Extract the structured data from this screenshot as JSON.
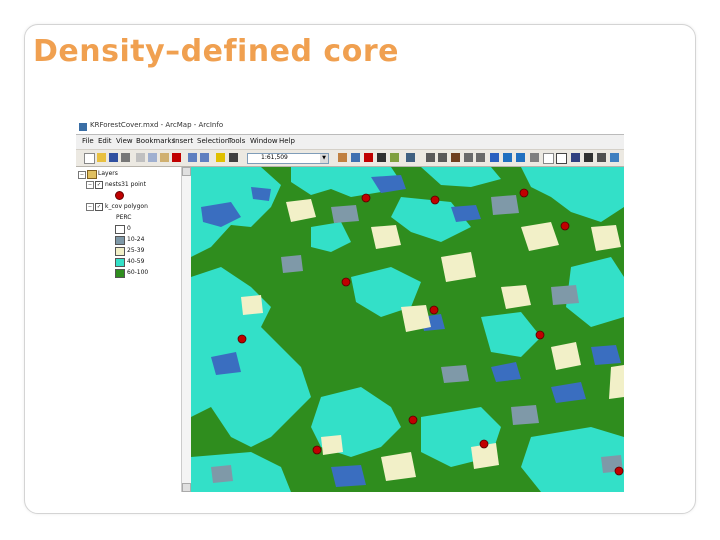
{
  "slide": {
    "title": "Density–defined core"
  },
  "window": {
    "title": "KRForestCover.mxd - ArcMap - ArcInfo"
  },
  "menubar": {
    "items": [
      "File",
      "Edit",
      "View",
      "Bookmarks",
      "Insert",
      "Selection",
      "Tools",
      "Window",
      "Help"
    ]
  },
  "toolbar": {
    "scale_value": "1:61,509"
  },
  "toc": {
    "root_label": "Layers",
    "layers": [
      {
        "label": "nests31 point",
        "checked": true
      },
      {
        "label": "k_cov polygon",
        "checked": true
      }
    ],
    "field_label": "PERC",
    "legend": [
      {
        "label": "0",
        "color": "#ffffff"
      },
      {
        "label": "10-24",
        "color": "#7f99a8"
      },
      {
        "label": "25-39",
        "color": "#f2f0c8"
      },
      {
        "label": "40-59",
        "color": "#33e0c8"
      },
      {
        "label": "60-100",
        "color": "#2f8d1e"
      }
    ]
  },
  "map": {
    "colors": {
      "dense_forest": "#2f8d1e",
      "medium_forest": "#33e0c8",
      "light_forest": "#f2f0c8",
      "sparse": "#7f99a8",
      "water": "#3a6ec0",
      "nest_point": "#c00000"
    },
    "nest_count": 13
  }
}
